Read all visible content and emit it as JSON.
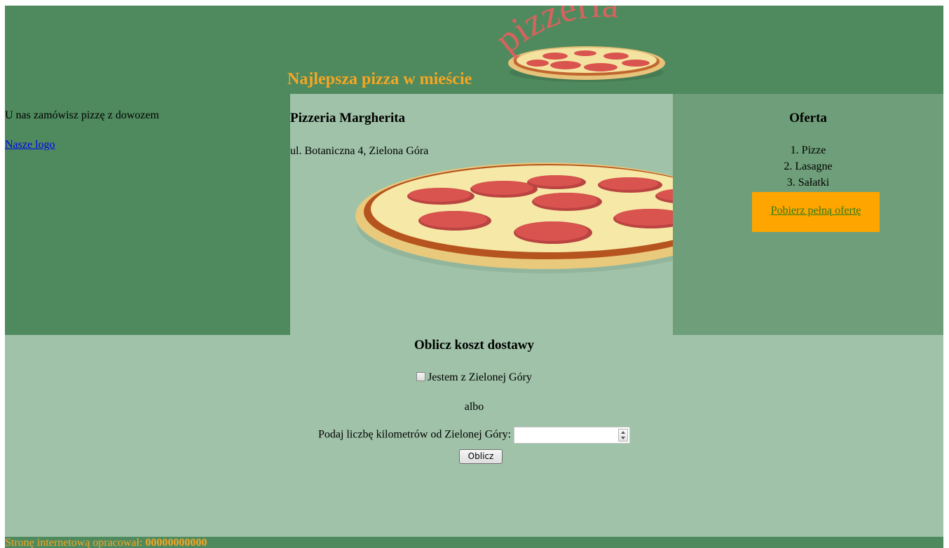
{
  "header": {
    "tagline": "Najlepsza pizza w mieście",
    "logo_text": "pizzeria"
  },
  "left": {
    "intro_text": "U nas zamówisz pizzę z dowozem",
    "logo_link": "Nasze logo"
  },
  "center": {
    "name": "Pizzeria Margherita",
    "address": "ul. Botaniczna 4, Zielona Góra"
  },
  "offer": {
    "title": "Oferta",
    "items": [
      "1. Pizze",
      "2. Lasagne",
      "3. Sałatki"
    ],
    "download_link": "Pobierz pełną ofertę"
  },
  "delivery": {
    "title": "Oblicz koszt dostawy",
    "checkbox_label": "Jestem z Zielonej Góry",
    "or_text": "albo",
    "km_label": "Podaj liczbę kilometrów od Zielonej Góry:",
    "km_value": "",
    "button_label": "Oblicz"
  },
  "footer": {
    "prefix": "Stronę internetową opracował:",
    "author": "00000000000"
  },
  "colors": {
    "header_green": "#4f8a5e",
    "light_green": "#9fc2a8",
    "right_green": "#6f9f7a",
    "accent_orange": "#f5a623",
    "button_orange": "#ffa500"
  }
}
